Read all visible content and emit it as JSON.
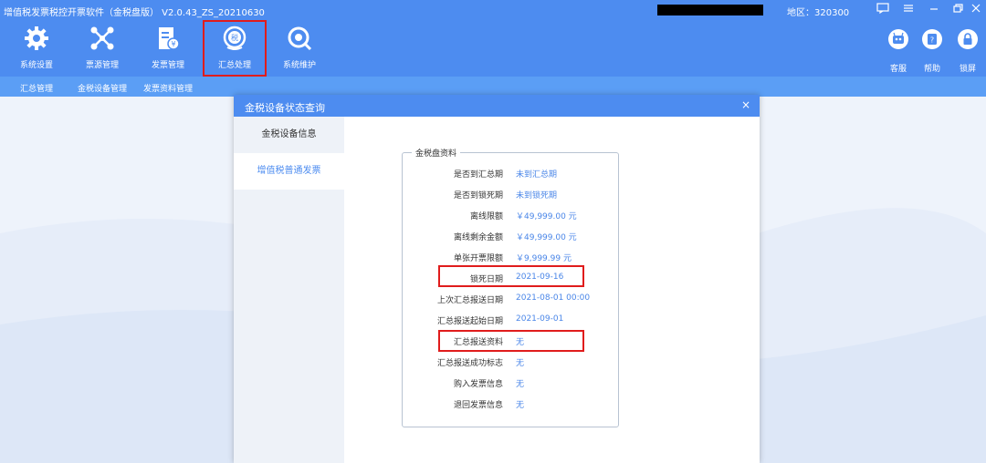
{
  "app": {
    "title": "增值税发票税控开票软件（金税盘版） V2.0.43_ZS_20210630",
    "region": "地区：320300"
  },
  "toolbar": {
    "items": [
      {
        "label": "系统设置"
      },
      {
        "label": "票源管理"
      },
      {
        "label": "发票管理"
      },
      {
        "label": "汇总处理"
      },
      {
        "label": "系统维护"
      }
    ],
    "right_items": [
      {
        "label": "客服"
      },
      {
        "label": "帮助"
      },
      {
        "label": "锁屏"
      }
    ]
  },
  "subnav": {
    "items": [
      {
        "label": "汇总管理"
      },
      {
        "label": "金税设备管理"
      },
      {
        "label": "发票资料管理"
      }
    ]
  },
  "dialog": {
    "title": "金税设备状态查询",
    "close": "×",
    "sidebar": [
      {
        "label": "金税设备信息"
      },
      {
        "label": "增值税普通发票"
      }
    ],
    "group_title": "金税盘资料",
    "rows": [
      {
        "key": "是否到汇总期",
        "value": "未到汇总期"
      },
      {
        "key": "是否到锁死期",
        "value": "未到锁死期"
      },
      {
        "key": "离线限额",
        "value": "￥49,999.00 元"
      },
      {
        "key": "离线剩余金额",
        "value": "￥49,999.00 元"
      },
      {
        "key": "单张开票限额",
        "value": "￥9,999.99 元"
      },
      {
        "key": "锁死日期",
        "value": "2021-09-16"
      },
      {
        "key": "上次汇总报送日期",
        "value": "2021-08-01 00:00"
      },
      {
        "key": "汇总报送起始日期",
        "value": "2021-09-01"
      },
      {
        "key": "汇总报送资料",
        "value": "无"
      },
      {
        "key": "汇总报送成功标志",
        "value": "无"
      },
      {
        "key": "购入发票信息",
        "value": "无"
      },
      {
        "key": "退回发票信息",
        "value": "无"
      }
    ]
  },
  "colors": {
    "primary": "#4d8cf0",
    "highlight": "#e01c1c",
    "value_text": "#4a86e8"
  }
}
